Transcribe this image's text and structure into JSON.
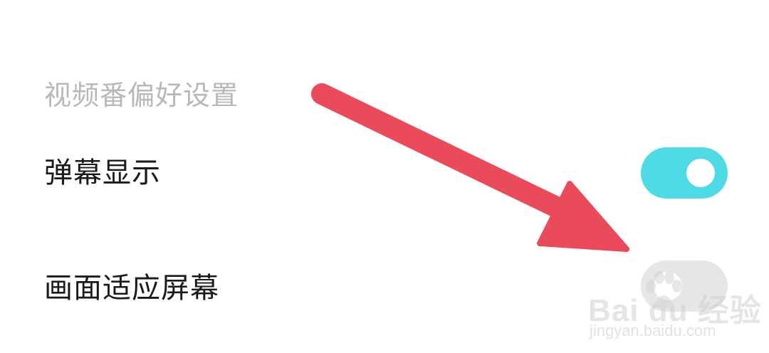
{
  "section": {
    "title": "视频番偏好设置"
  },
  "settings": [
    {
      "label": "弹幕显示",
      "enabled": true
    },
    {
      "label": "画面适应屏幕",
      "enabled": false
    }
  ],
  "colors": {
    "toggle_on": "#4fdbe6",
    "toggle_off": "#e6e6e6",
    "arrow": "#e94b5b",
    "section_title": "#b8b8b8",
    "label": "#1a1a1a"
  },
  "overlay": {
    "arrow_icon": "arrow-annotation-icon"
  },
  "watermark": {
    "brand": "Bai du 经验",
    "url": "jingyan.baidu.com"
  }
}
